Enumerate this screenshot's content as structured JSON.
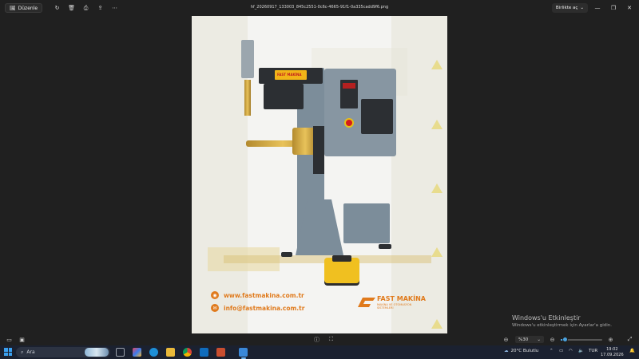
{
  "titlebar": {
    "edit_label": "Düzenle",
    "filename": "hf_20260917_133003_845c2551-0c6c-4665-91f1-0a335cadd9f6.png",
    "open_with_label": "Birlikte aç",
    "icons": [
      "rotate-icon",
      "delete-icon",
      "print-icon",
      "share-icon",
      "more-icon"
    ]
  },
  "photo": {
    "website": "www.fastmakina.com.tr",
    "email": "info@fastmakina.com.tr",
    "brand_name": "FAST MAKİNA",
    "brand_tagline": "MAKİNA VE OTOMASYON SİSTEMLERİ",
    "machine_label": "FAST MAKİNA"
  },
  "activation": {
    "title": "Windows'u Etkinleştir",
    "subtitle": "Windows'u etkinleştirmek için Ayarlar'a gidin."
  },
  "viewer": {
    "zoom": "%30",
    "zoom_fraction": 0.1
  },
  "taskbar": {
    "search_placeholder": "Ara",
    "weather": "20°C  Bulutlu",
    "language": "TUR",
    "time": "19:02",
    "date": "17.09.2026"
  },
  "colors": {
    "accent": "#e07a1c",
    "machine_body": "#7c8d9a",
    "pedal": "#f0c020"
  }
}
